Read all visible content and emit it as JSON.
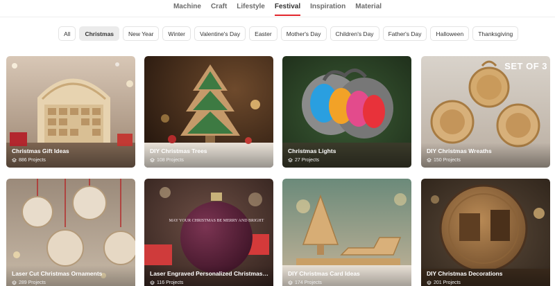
{
  "top_nav": [
    {
      "label": "Machine",
      "active": false
    },
    {
      "label": "Craft",
      "active": false
    },
    {
      "label": "Lifestyle",
      "active": false
    },
    {
      "label": "Festival",
      "active": true
    },
    {
      "label": "Inspiration",
      "active": false
    },
    {
      "label": "Material",
      "active": false
    }
  ],
  "filters": [
    {
      "label": "All",
      "active": false
    },
    {
      "label": "Christmas",
      "active": true
    },
    {
      "label": "New Year",
      "active": false
    },
    {
      "label": "Winter",
      "active": false
    },
    {
      "label": "Valentine's Day",
      "active": false
    },
    {
      "label": "Easter",
      "active": false
    },
    {
      "label": "Mother's Day",
      "active": false
    },
    {
      "label": "Children's Day",
      "active": false
    },
    {
      "label": "Father's Day",
      "active": false
    },
    {
      "label": "Halloween",
      "active": false
    },
    {
      "label": "Thanksgiving",
      "active": false
    }
  ],
  "cards": [
    {
      "title": "Christmas Gift Ideas",
      "count": "886 Projects",
      "image": "wooden-advent-calendar-house",
      "badge": ""
    },
    {
      "title": "DIY Christmas Trees",
      "count": "108 Projects",
      "image": "layered-wooden-christmas-tree",
      "badge": ""
    },
    {
      "title": "Christmas Lights",
      "count": "27 Projects",
      "image": "colored-christmas-light-bulbs",
      "badge": ""
    },
    {
      "title": "DIY Christmas Wreaths",
      "count": "150 Projects",
      "image": "wooden-ornament-set",
      "badge": "SET OF 3"
    },
    {
      "title": "Laser Cut Christmas Ornaments",
      "count": "289 Projects",
      "image": "hanging-wooden-ornaments",
      "badge": ""
    },
    {
      "title": "Laser Engraved Personalized Christmas Or...",
      "count": "116 Projects",
      "image": "engraved-red-bauble",
      "badge": ""
    },
    {
      "title": "DIY Christmas Card Ideas",
      "count": "174 Projects",
      "image": "wooden-tree-and-sleigh",
      "badge": ""
    },
    {
      "title": "DIY Christmas Decorations",
      "count": "201 Projects",
      "image": "engraved-santa-plaque",
      "badge": ""
    }
  ],
  "bauble_text": "MAY YOUR CHRISTMAS BE MERRY AND BRIGHT",
  "icons": {
    "project_count": "layers-icon"
  },
  "colors": {
    "accent": "#e2242b",
    "chip_active_bg": "#ebebeb"
  }
}
